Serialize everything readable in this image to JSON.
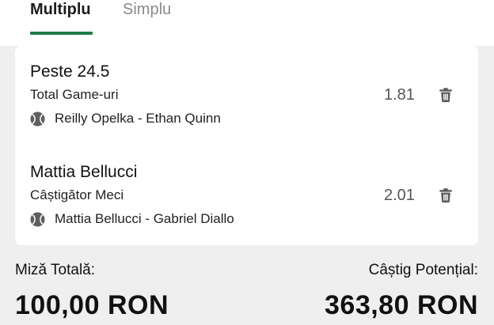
{
  "tabs": [
    {
      "label": "Multiplu",
      "active": true
    },
    {
      "label": "Simplu",
      "active": false
    }
  ],
  "colors": {
    "accent": "#1f7a4a",
    "background": "#efefef",
    "card": "#ffffff",
    "muted": "#8a8a8a"
  },
  "selections": [
    {
      "title": "Peste 24.5",
      "market": "Total Game-uri",
      "event": "Reilly Opelka - Ethan Quinn",
      "odds": "1.81",
      "sport_icon": "tennis-ball-icon",
      "remove_icon": "trash-icon"
    },
    {
      "title": "Mattia Bellucci",
      "market": "Câștigător Meci",
      "event": "Mattia Bellucci - Gabriel Diallo",
      "odds": "2.01",
      "sport_icon": "tennis-ball-icon",
      "remove_icon": "trash-icon"
    }
  ],
  "footer": {
    "stake_label": "Miză Totală:",
    "stake_value": "100,00 RON",
    "win_label": "Câștig Potențial:",
    "win_value": "363,80 RON"
  }
}
